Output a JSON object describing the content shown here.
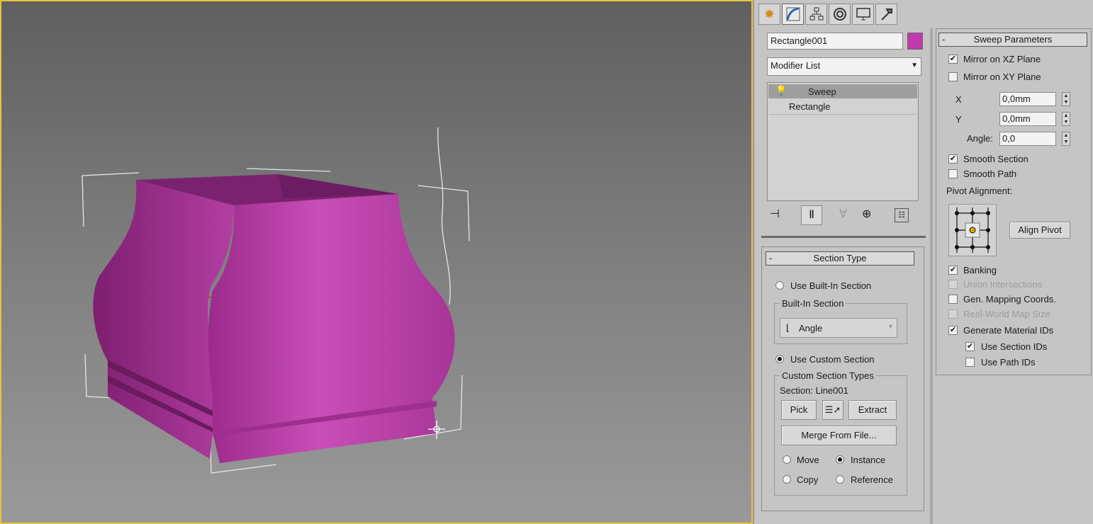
{
  "command_tabs": [
    {
      "icon": "create-icon"
    },
    {
      "icon": "modify-icon"
    },
    {
      "icon": "hierarchy-icon"
    },
    {
      "icon": "motion-icon"
    },
    {
      "icon": "display-icon"
    },
    {
      "icon": "utilities-icon"
    }
  ],
  "object": {
    "name": "Rectangle001",
    "color": "#c23aaf"
  },
  "modifier_list": {
    "label": "Modifier List"
  },
  "stack": {
    "items": [
      {
        "label": "Sweep"
      },
      {
        "label": "Rectangle"
      }
    ]
  },
  "section_type": {
    "title": "Section Type",
    "use_builtin_label": "Use Built-In Section",
    "builtin_group": "Built-In Section",
    "builtin_value": "Angle",
    "use_custom_label": "Use Custom Section",
    "custom_group": "Custom Section Types",
    "section_label": "Section: Line001",
    "pick": "Pick",
    "extract": "Extract",
    "merge": "Merge From File...",
    "move": "Move",
    "instance": "Instance",
    "copy": "Copy",
    "reference": "Reference"
  },
  "sweep_params": {
    "title": "Sweep Parameters",
    "mirror_xz": "Mirror on XZ Plane",
    "mirror_xy": "Mirror on XY Plane",
    "x_label": "X",
    "x_value": "0,0mm",
    "y_label": "Y",
    "y_value": "0,0mm",
    "angle_label": "Angle:",
    "angle_value": "0,0",
    "smooth_section": "Smooth Section",
    "smooth_path": "Smooth Path",
    "pivot_alignment": "Pivot Alignment:",
    "align_pivot": "Align Pivot",
    "banking": "Banking",
    "union": "Union Intersections",
    "gen_mapping": "Gen. Mapping Coords.",
    "real_world": "Real-World Map Size",
    "gen_material": "Generate Material IDs",
    "use_section_ids": "Use Section IDs",
    "use_path_ids": "Use Path IDs"
  },
  "colors": {
    "object": "#c23aaf",
    "viewport_border": "#e8c33a"
  }
}
